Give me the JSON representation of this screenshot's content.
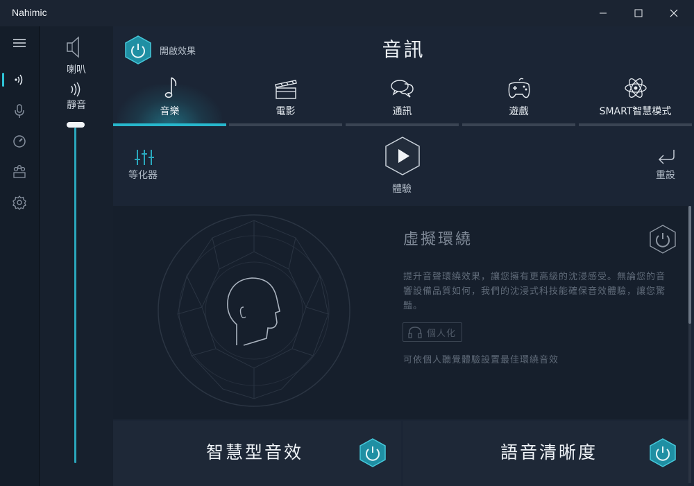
{
  "window": {
    "title": "Nahimic"
  },
  "volume": {
    "speaker_label": "喇叭",
    "mute_label": "靜音",
    "level": 1.0
  },
  "header": {
    "effect_label": "開啟效果",
    "page_title": "音訊"
  },
  "tabs": [
    {
      "label": "音樂",
      "icon": "music-note-icon",
      "active": true
    },
    {
      "label": "電影",
      "icon": "clapperboard-icon",
      "active": false
    },
    {
      "label": "通訊",
      "icon": "chat-bubbles-icon",
      "active": false
    },
    {
      "label": "遊戲",
      "icon": "gamepad-icon",
      "active": false
    },
    {
      "label": "SMART智慧模式",
      "icon": "atom-icon",
      "active": false
    }
  ],
  "toolbar": {
    "equalizer_label": "等化器",
    "experience_label": "體驗",
    "reset_label": "重設"
  },
  "surround": {
    "title": "虛擬環繞",
    "description": "提升音聲環繞效果，讓您擁有更高級的沈浸感受。無論您的音響設備品質如何，我們的沈浸式科技能確保音效體驗，讓您驚豔。",
    "personalize_label": "個人化",
    "hint": "可依個人聽覺體驗設置最佳環繞音效"
  },
  "cards": [
    {
      "label": "智慧型音效"
    },
    {
      "label": "語音清晰度"
    }
  ],
  "colors": {
    "accent": "#27b7cc",
    "background": "#1b2535",
    "titlebar": "#1b2432"
  }
}
